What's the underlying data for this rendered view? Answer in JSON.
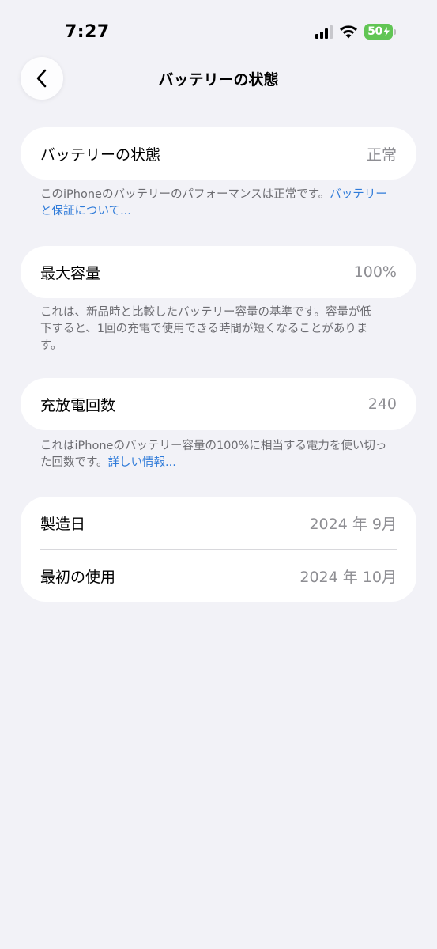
{
  "status_bar": {
    "time": "7:27",
    "battery_level": "50",
    "battery_color": "#61c554"
  },
  "nav": {
    "back_icon": "chevron-left-icon",
    "title": "バッテリーの状態"
  },
  "battery_health": {
    "label": "バッテリーの状態",
    "value": "正常",
    "footnote": "このiPhoneのバッテリーのパフォーマンスは正常です。",
    "link": "バッテリーと保証について..."
  },
  "max_capacity": {
    "label": "最大容量",
    "value": "100%",
    "footnote": "これは、新品時と比較したバッテリー容量の基準です。容量が低下すると、1回の充電で使用できる時間が短くなることがあります。"
  },
  "cycle_count": {
    "label": "充放電回数",
    "value": "240",
    "footnote": "これはiPhoneのバッテリー容量の100%に相当する電力を使い切った回数です。",
    "link": "詳しい情報..."
  },
  "dates": {
    "manufacture_label": "製造日",
    "manufacture_value": "2024 年 9月",
    "first_use_label": "最初の使用",
    "first_use_value": "2024 年 10月"
  },
  "colors": {
    "background": "#f2f2f7",
    "link": "#2f7bd9",
    "secondary_text": "#8e8e93"
  }
}
